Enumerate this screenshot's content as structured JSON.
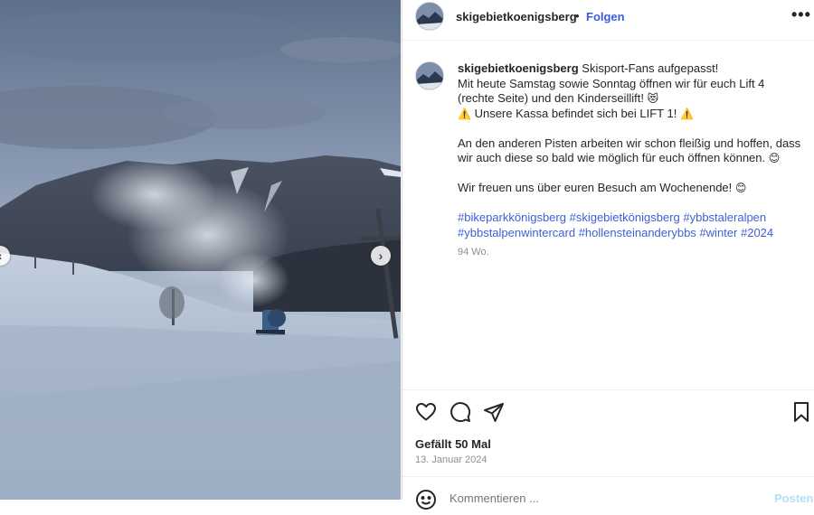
{
  "post": {
    "username": "skigebietkoenigsberg",
    "separator": "•",
    "follow_label": "Folgen",
    "more_label": "•••",
    "caption": {
      "username": "skigebietkoenigsberg",
      "line1": "Skisport-Fans aufgepasst!",
      "line2": "Mit heute Samstag sowie Sonntag öffnen wir für euch Lift 4 (rechte Seite) und den Kinderseillift!",
      "line2_emoji": "😻",
      "line3_warn_left": "⚠️",
      "line3": "Unsere Kassa befindet sich bei LIFT 1!",
      "line3_warn_right": "⚠️",
      "line4": "An den anderen Pisten arbeiten wir schon fleißig und hoffen, dass wir auch diese so bald wie möglich für euch öffnen können.",
      "line4_emoji": "😊",
      "line5": "Wir freuen uns über euren Besuch am Wochenende!",
      "line5_emoji": "😊",
      "hashtags": [
        "#bikeparkkönigsberg",
        "#skigebietkönigsberg",
        "#ybbstaleralpen",
        "#ybbstalpenwintercard",
        "#hollensteinanderybbs",
        "#winter",
        "#2024"
      ],
      "time_ago": "94 Wo."
    },
    "likes": "Gefällt 50 Mal",
    "date": "13. Januar 2024",
    "comment_placeholder": "Kommentieren ...",
    "post_button": "Posten"
  },
  "icons": {
    "like": "heart-icon",
    "comment": "comment-icon",
    "share": "send-icon",
    "save": "bookmark-icon",
    "emoji": "smiley-icon",
    "more": "more-icon"
  },
  "carousel": {
    "prev_label": "‹",
    "next_label": "›"
  }
}
